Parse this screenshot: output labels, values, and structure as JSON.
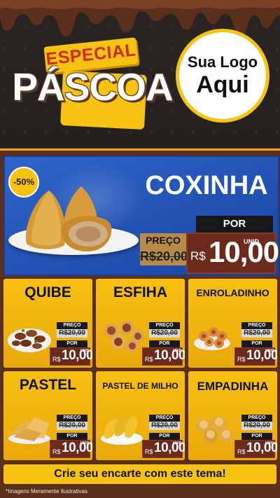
{
  "header": {
    "special": "ESPECIAL",
    "title": "PÁSCOA",
    "logo_line1": "Sua Logo",
    "logo_line2": "Aqui"
  },
  "hero": {
    "discount": "-50%",
    "title": "COXINHA",
    "preco_label": "PREÇO",
    "old_price": "R$20,00",
    "por_label": "POR",
    "unid": "UNID",
    "currency": "R$",
    "price": "10,00"
  },
  "cards": [
    {
      "title": "QUIBE",
      "preco_label": "PREÇO",
      "old_price": "R$20,00",
      "por_label": "POR",
      "currency": "R$",
      "price": "10,00",
      "unid": "UNID"
    },
    {
      "title": "ESFIHA",
      "preco_label": "PREÇO",
      "old_price": "R$20,00",
      "por_label": "POR",
      "currency": "R$",
      "price": "10,00",
      "unid": "UNID"
    },
    {
      "title": "ENROLADINHO",
      "preco_label": "PREÇO",
      "old_price": "R$20,00",
      "por_label": "POR",
      "currency": "R$",
      "price": "10,00",
      "unid": "UNID"
    },
    {
      "title": "PASTEL",
      "preco_label": "PREÇO",
      "old_price": "R$20,00",
      "por_label": "POR",
      "currency": "R$",
      "price": "10,00",
      "unid": "UNID"
    },
    {
      "title": "PASTEL DE MILHO",
      "preco_label": "PREÇO",
      "old_price": "R$20,00",
      "por_label": "POR",
      "currency": "R$",
      "price": "10,00",
      "unid": "UNID"
    },
    {
      "title": "EMPADINHA",
      "preco_label": "PREÇO",
      "old_price": "R$20,00",
      "por_label": "POR",
      "currency": "R$",
      "price": "10,00",
      "unid": "UNID"
    }
  ],
  "footer": {
    "cta": "Crie seu encarte com este tema!",
    "note": "*Imagens Meramente Ilustrativas"
  },
  "colors": {
    "background": "#1f1b1a",
    "accent_yellow": "#f7c312",
    "hero_blue": "#2f64c8",
    "price_brown": "#6b2a1c",
    "special_red": "#d02b19"
  }
}
